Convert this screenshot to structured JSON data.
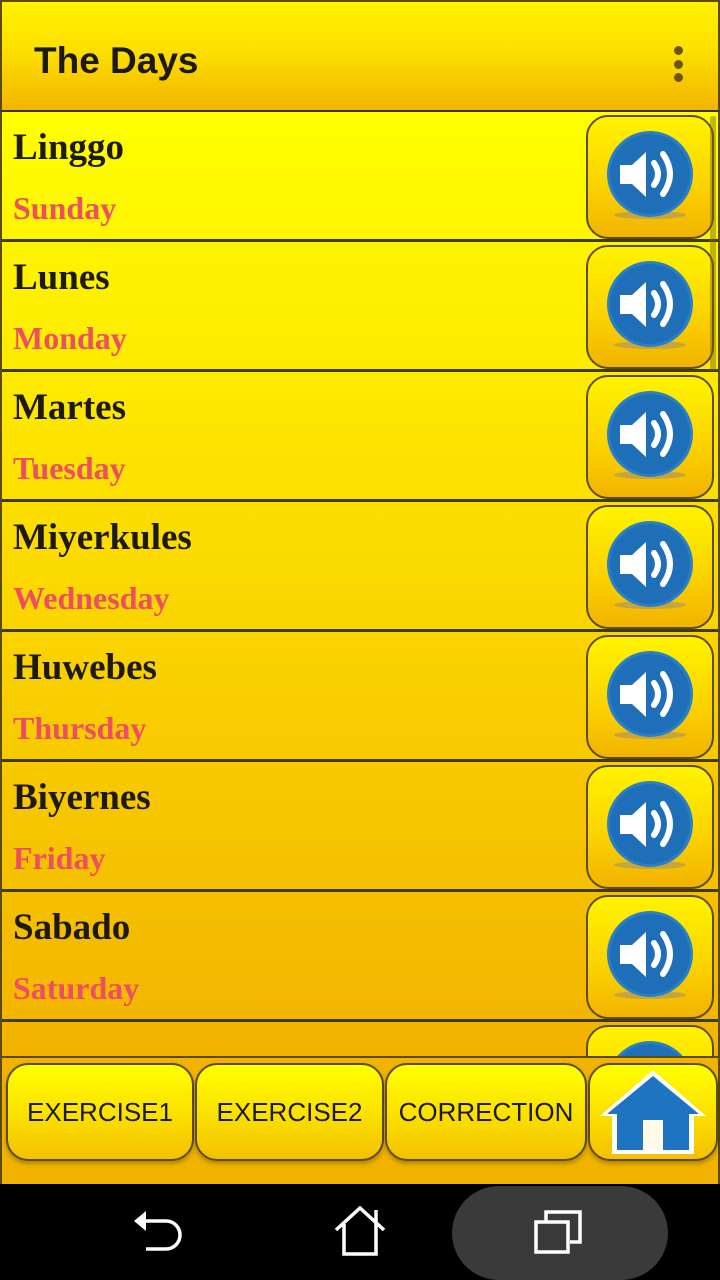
{
  "app_bar": {
    "title": "The Days",
    "menu_icon": "overflow-vertical-icon"
  },
  "colors": {
    "native_text": "#1d1a12",
    "english_text": "#ee4e63",
    "speaker_blue": "#1e74c0",
    "accent_yellow": "#ffff00",
    "accent_orange": "#f2b300"
  },
  "list": {
    "items": [
      {
        "native": "Linggo",
        "english": "Sunday",
        "icon": "speaker-icon"
      },
      {
        "native": "Lunes",
        "english": "Monday",
        "icon": "speaker-icon"
      },
      {
        "native": "Martes",
        "english": "Tuesday",
        "icon": "speaker-icon"
      },
      {
        "native": "Miyerkules",
        "english": "Wednesday",
        "icon": "speaker-icon"
      },
      {
        "native": "Huwebes",
        "english": "Thursday",
        "icon": "speaker-icon"
      },
      {
        "native": "Biyernes",
        "english": "Friday",
        "icon": "speaker-icon"
      },
      {
        "native": "Sabado",
        "english": "Saturday",
        "icon": "speaker-icon"
      },
      {
        "native": "",
        "english": "",
        "icon": "speaker-icon"
      }
    ]
  },
  "bottom_bar": {
    "exercise1_label": "EXERCISE1",
    "exercise2_label": "EXERCISE2",
    "correction_label": "CORRECTION",
    "home_icon": "house-icon"
  },
  "system_nav": {
    "back_icon": "back-icon",
    "home_icon": "home-icon",
    "recents_icon": "recents-icon"
  }
}
